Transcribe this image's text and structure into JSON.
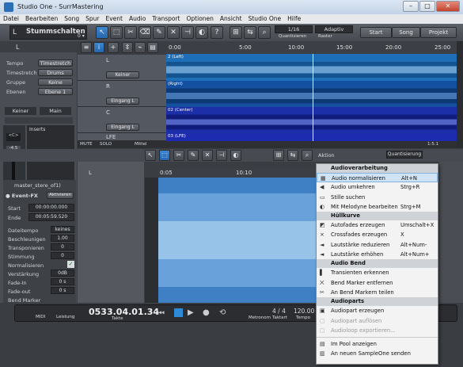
{
  "window": {
    "title": "Studio One - SurrMastering",
    "btn_min": "–",
    "btn_max": "□",
    "btn_close": "✕"
  },
  "menu": [
    "Datei",
    "Bearbeiten",
    "Song",
    "Spur",
    "Event",
    "Audio",
    "Transport",
    "Optionen",
    "Ansicht",
    "Studio One",
    "Hilfe"
  ],
  "toolbar": {
    "track_num": "L",
    "track_name": "Stummschalten",
    "track_hint": "0 ▾",
    "quantize_value": "1/16",
    "quantize_label": "Quantisieren",
    "snap_value": "Adaptiv",
    "snap_label": "Raster",
    "start": "Start",
    "song": "Song",
    "projekt": "Projekt"
  },
  "inspector": {
    "letter": "L",
    "fields": [
      {
        "label": "Tempo",
        "value": "Timestretch"
      },
      {
        "label": "Timestretch",
        "value": "Drums"
      },
      {
        "label": "Gruppe",
        "value": "Keine"
      },
      {
        "label": "Ebenen",
        "value": "Ebene 1"
      }
    ],
    "tab_none": "Keiner",
    "tab_main": "Main",
    "inserts": "Inserts",
    "gain": "-4.5",
    "knob_l": "<C>",
    "knob_r": "0",
    "channel_l": "L",
    "channel_r": "L"
  },
  "tracks": [
    {
      "name": "L",
      "input": "Keiner"
    },
    {
      "name": "R",
      "input": "Eingang L"
    },
    {
      "name": "C",
      "input": "Eingang L"
    },
    {
      "name": "LFE",
      "input": ""
    }
  ],
  "track_bottom": {
    "mute": "MUTE",
    "solo": "SOLO",
    "mid": "Mittel"
  },
  "arrange": {
    "ruler": [
      "0:00",
      "5:00",
      "10:00",
      "15:00",
      "20:00",
      "25:00"
    ],
    "lane_labels": [
      "2 (Left)",
      "(Right)",
      "02 (Center)",
      "03 (LFE)"
    ],
    "counter": "1:5.1"
  },
  "editor": {
    "track_letter": "L",
    "event_name": "master_stere_of1)",
    "event_fx": "● Event-FX",
    "aktivieren": "Aktivieren",
    "action": "Aktion",
    "quantize": "Quantisierung",
    "ruler": [
      "0:05",
      "10:10"
    ],
    "start_label": "Start",
    "start_value": "00:00:00.000",
    "ende_label": "Ende",
    "ende_value": "00:05:59.520",
    "params": [
      {
        "label": "Dateitempo",
        "value": "keines"
      },
      {
        "label": "Beschleunigen",
        "value": "1.00"
      },
      {
        "label": "Transponieren",
        "value": "0"
      },
      {
        "label": "Stimmung",
        "value": "0"
      },
      {
        "label": "Normalisieren",
        "value": "✓"
      },
      {
        "label": "Verstärkung",
        "value": "0dB"
      },
      {
        "label": "Fade-In",
        "value": "0 s"
      },
      {
        "label": "Fade-out",
        "value": "0 s"
      },
      {
        "label": "Bend Marker",
        "value": ""
      }
    ],
    "zoom": "40.5",
    "browse": "rowse"
  },
  "context_menu": {
    "sections": [
      {
        "header": "Audioverarbeitung",
        "items": [
          {
            "icon": "normalize-icon",
            "label": "Audio normalisieren",
            "shortcut": "Alt+N",
            "highlight": true
          },
          {
            "icon": "reverse-icon",
            "label": "Audio umkehren",
            "shortcut": "Strg+R"
          },
          {
            "icon": "silence-icon",
            "label": "Stille suchen",
            "shortcut": ""
          },
          {
            "icon": "melodyne-icon",
            "label": "Mit Melodyne bearbeiten",
            "shortcut": "Strg+M"
          }
        ]
      },
      {
        "header": "Hüllkurve",
        "items": [
          {
            "icon": "autofade-icon",
            "label": "Autofades erzeugen",
            "shortcut": "Umschalt+X"
          },
          {
            "icon": "crossfade-icon",
            "label": "Crossfades erzeugen",
            "shortcut": "X"
          },
          {
            "icon": "volume-down-icon",
            "label": "Lautstärke reduzieren",
            "shortcut": "Alt+Num-"
          },
          {
            "icon": "volume-up-icon",
            "label": "Lautstärke erhöhen",
            "shortcut": "Alt+Num+"
          }
        ]
      },
      {
        "header": "Audio Bend",
        "items": [
          {
            "icon": "transient-icon",
            "label": "Transienten erkennen",
            "shortcut": ""
          },
          {
            "icon": "bend-remove-icon",
            "label": "Bend Marker entfernen",
            "shortcut": ""
          },
          {
            "icon": "bend-split-icon",
            "label": "An Bend Markern teilen",
            "shortcut": ""
          }
        ]
      },
      {
        "header": "Audioparts",
        "items": [
          {
            "icon": "part-create-icon",
            "label": "Audiopart erzeugen",
            "shortcut": ""
          },
          {
            "icon": "part-dissolve-icon",
            "label": "Audiopart auflösen",
            "shortcut": "",
            "disabled": true
          },
          {
            "icon": "loop-export-icon",
            "label": "Audioloop exportieren...",
            "shortcut": "",
            "disabled": true
          }
        ]
      },
      {
        "header": "",
        "items": [
          {
            "icon": "pool-icon",
            "label": "Im Pool anzeigen",
            "shortcut": ""
          },
          {
            "icon": "sampleone-icon",
            "label": "An neuen SampleOne senden",
            "shortcut": ""
          }
        ]
      }
    ]
  },
  "transport": {
    "midi": "MIDI",
    "leistung": "Leistung",
    "position": "0533.04.01.34",
    "position_label": "Takte",
    "metronom": "Metronom",
    "taktart": "4 / 4",
    "taktart_label": "Taktart",
    "tempo": "120.00",
    "tempo_label": "Tempo"
  }
}
